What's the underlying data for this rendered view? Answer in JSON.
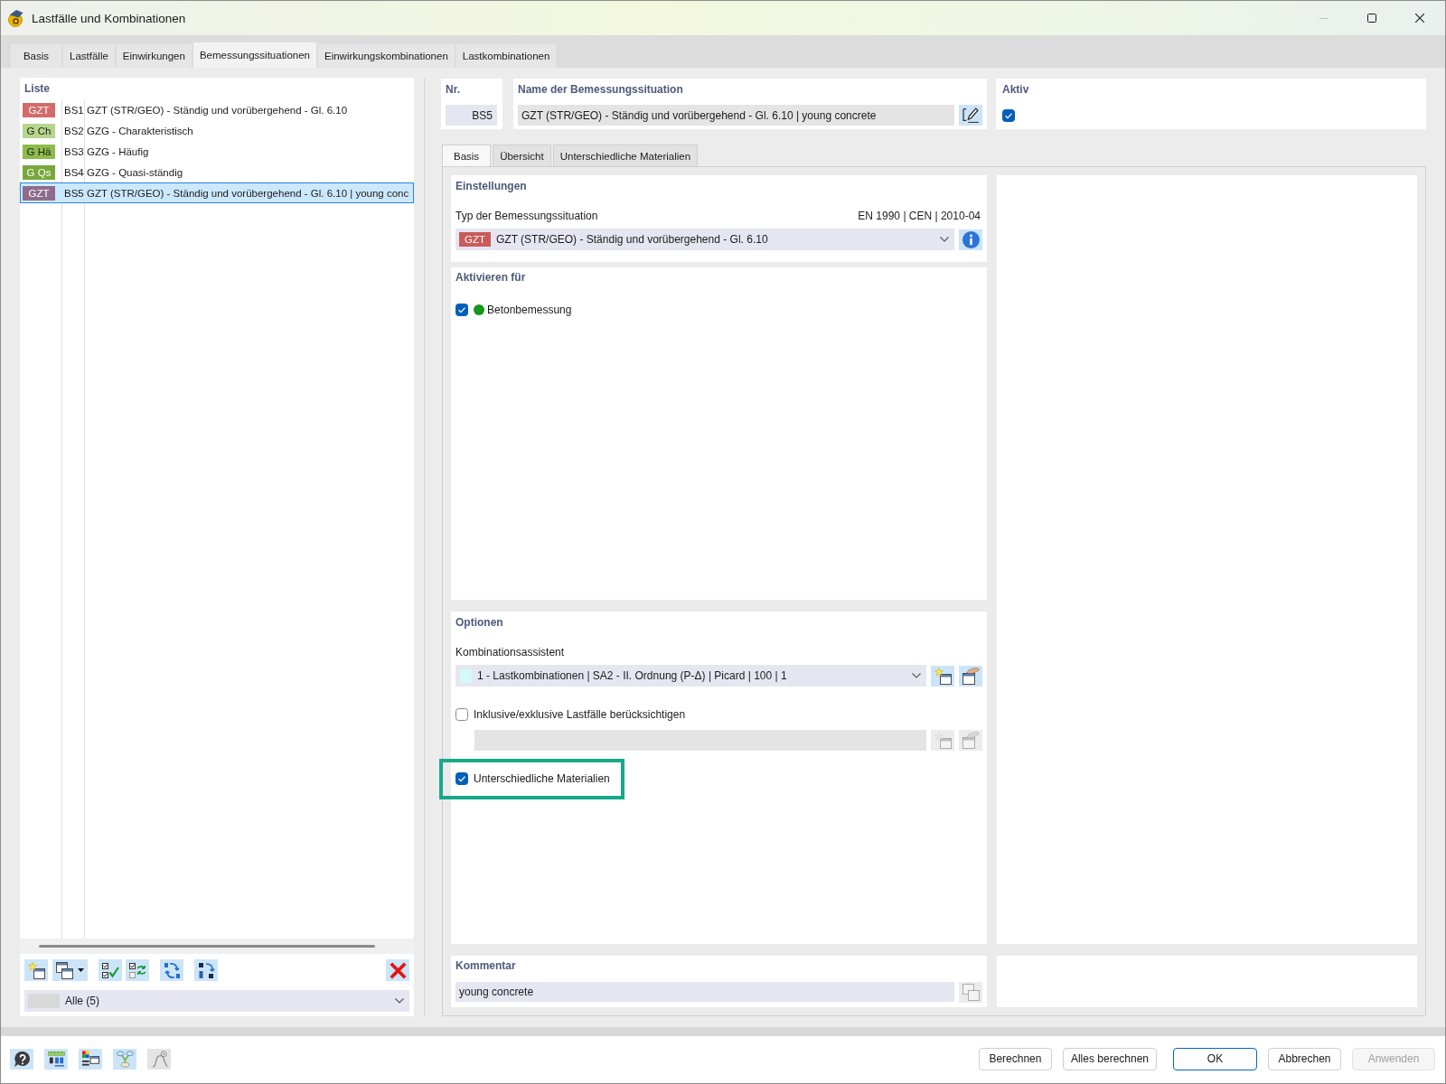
{
  "window": {
    "title": "Lastfälle und Kombinationen"
  },
  "tabs": [
    {
      "label": "Basis",
      "selected": false
    },
    {
      "label": "Lastfälle",
      "selected": false
    },
    {
      "label": "Einwirkungen",
      "selected": false
    },
    {
      "label": "Bemessungssituationen",
      "selected": true
    },
    {
      "label": "Einwirkungskombinationen",
      "selected": false
    },
    {
      "label": "Lastkombinationen",
      "selected": false
    }
  ],
  "list": {
    "title": "Liste",
    "items": [
      {
        "badge": "GZT",
        "color": "#d46a6a",
        "number": "BS1",
        "name": "GZT (STR/GEO) - Ständig und vorübergehend - Gl. 6.10",
        "selected": false
      },
      {
        "badge": "G Ch",
        "color": "#b5d58c",
        "number": "BS2",
        "name": "GZG - Charakteristisch",
        "selected": false
      },
      {
        "badge": "G Hä",
        "color": "#8cbc4c",
        "number": "BS3",
        "name": "GZG - Häufig",
        "selected": false
      },
      {
        "badge": "G Qs",
        "color": "#78a83c",
        "number": "BS4",
        "name": "GZG - Quasi-ständig",
        "selected": false
      },
      {
        "badge": "GZT",
        "color": "#906c8c",
        "number": "BS5",
        "name": "GZT (STR/GEO) - Ständig und vorübergehend - Gl. 6.10 | young conc",
        "selected": true
      }
    ],
    "filter": {
      "value": "Alle (5)"
    }
  },
  "header": {
    "number": {
      "label": "Nr.",
      "value": "BS5"
    },
    "name": {
      "label": "Name der Bemessungssituation",
      "value": "GZT (STR/GEO) - Ständig und vorübergehend - Gl. 6.10 | young concrete"
    },
    "active": {
      "label": "Aktiv",
      "checked": true
    }
  },
  "detail_tabs": [
    {
      "label": "Basis",
      "selected": true
    },
    {
      "label": "Übersicht",
      "selected": false
    },
    {
      "label": "Unterschiedliche Materialien",
      "selected": false
    }
  ],
  "settings": {
    "title": "Einstellungen",
    "type_label": "Typ der Bemessungssituation",
    "standard": "EN 1990 | CEN | 2010-04",
    "type": {
      "badge": "GZT",
      "color": "#c95b5b",
      "value": "GZT (STR/GEO) - Ständig und vorübergehend - Gl. 6.10"
    }
  },
  "activate_for": {
    "title": "Aktivieren für",
    "items": [
      {
        "label": "Betonbemessung",
        "checked": true,
        "color": "#16961a"
      }
    ]
  },
  "options": {
    "title": "Optionen",
    "wizard": {
      "label": "Kombinationsassistent",
      "value": "1 - Lastkombinationen | SA2 - II. Ordnung (P-Δ) | Picard | 100 | 1",
      "color": "#d4fafa"
    },
    "checks": [
      {
        "kind": "checkbox_with_list",
        "label": "Inklusive/exklusive Lastfälle berücksichtigen",
        "checked": false,
        "highlighted": false
      },
      {
        "kind": "checkbox",
        "label": "Unterschiedliche Materialien",
        "checked": true,
        "highlighted": true
      }
    ]
  },
  "comment": {
    "title": "Kommentar",
    "value": "young concrete"
  },
  "footer_buttons": [
    {
      "label": "Berechnen",
      "default": false,
      "disabled": false
    },
    {
      "label": "Alles berechnen",
      "default": false,
      "disabled": false
    },
    {
      "label": "OK",
      "default": true,
      "disabled": false
    },
    {
      "label": "Abbrechen",
      "default": false,
      "disabled": false
    },
    {
      "label": "Anwenden",
      "default": false,
      "disabled": true
    }
  ]
}
